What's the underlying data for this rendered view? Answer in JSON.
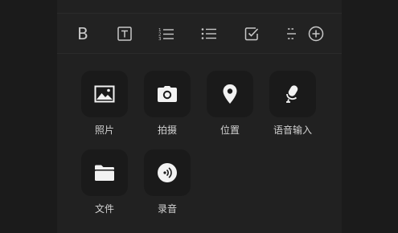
{
  "toolbar": {
    "bold_label": "B",
    "items": [
      {
        "icon": "bold-icon"
      },
      {
        "icon": "text-box-icon"
      },
      {
        "icon": "numbered-list-icon"
      },
      {
        "icon": "bullet-list-icon"
      },
      {
        "icon": "checkbox-icon"
      },
      {
        "icon": "divider-icon"
      },
      {
        "icon": "add-circle-icon"
      }
    ]
  },
  "attachments": [
    {
      "label": "照片",
      "icon": "image-icon"
    },
    {
      "label": "拍摄",
      "icon": "camera-icon"
    },
    {
      "label": "位置",
      "icon": "location-pin-icon"
    },
    {
      "label": "语音输入",
      "icon": "microphone-icon"
    },
    {
      "label": "文件",
      "icon": "folder-icon"
    },
    {
      "label": "录音",
      "icon": "audio-record-icon"
    }
  ],
  "colors": {
    "background": "#1b1b1b",
    "panel": "#212121",
    "tile": "#1a1a1a",
    "icon": "#f2f2f2",
    "toolbar_icon": "#c8c8c8",
    "label": "#d2d2d2"
  }
}
